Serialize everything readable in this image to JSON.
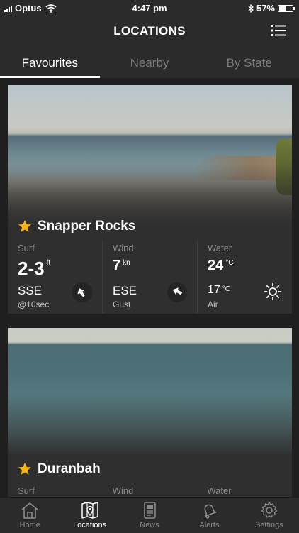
{
  "status": {
    "carrier": "Optus",
    "time": "4:47 pm",
    "battery": "57%",
    "battery_fraction": 0.57
  },
  "header": {
    "title": "LOCATIONS",
    "menu_icon": "list-icon"
  },
  "tabs": [
    {
      "label": "Favourites",
      "active": true
    },
    {
      "label": "Nearby",
      "active": false
    },
    {
      "label": "By State",
      "active": false
    }
  ],
  "locations": [
    {
      "name": "Snapper Rocks",
      "favourite": true,
      "surf": {
        "label": "Surf",
        "height": "2-3",
        "unit": "ft",
        "direction": "SSE",
        "period": "@10sec"
      },
      "wind": {
        "label": "Wind",
        "speed": "7",
        "unit": "kn",
        "direction": "ESE",
        "note": "Gust"
      },
      "water": {
        "label": "Water",
        "temp": "24",
        "unit": "°C",
        "air_temp": "17",
        "air_unit": "°C",
        "air_label": "Air",
        "weather_icon": "sun-icon"
      }
    },
    {
      "name": "Duranbah",
      "favourite": true,
      "surf": {
        "label": "Surf"
      },
      "wind": {
        "label": "Wind"
      },
      "water": {
        "label": "Water"
      }
    }
  ],
  "tabbar": [
    {
      "label": "Home",
      "icon": "home-icon",
      "active": false
    },
    {
      "label": "Locations",
      "icon": "map-pin-icon",
      "active": true
    },
    {
      "label": "News",
      "icon": "news-icon",
      "active": false
    },
    {
      "label": "Alerts",
      "icon": "bell-icon",
      "active": false
    },
    {
      "label": "Settings",
      "icon": "gear-icon",
      "active": false
    }
  ],
  "colors": {
    "background": "#1f1f1f",
    "card": "#2f2f2f",
    "star": "#f5b21b",
    "inactive": "#8a8a8a"
  }
}
